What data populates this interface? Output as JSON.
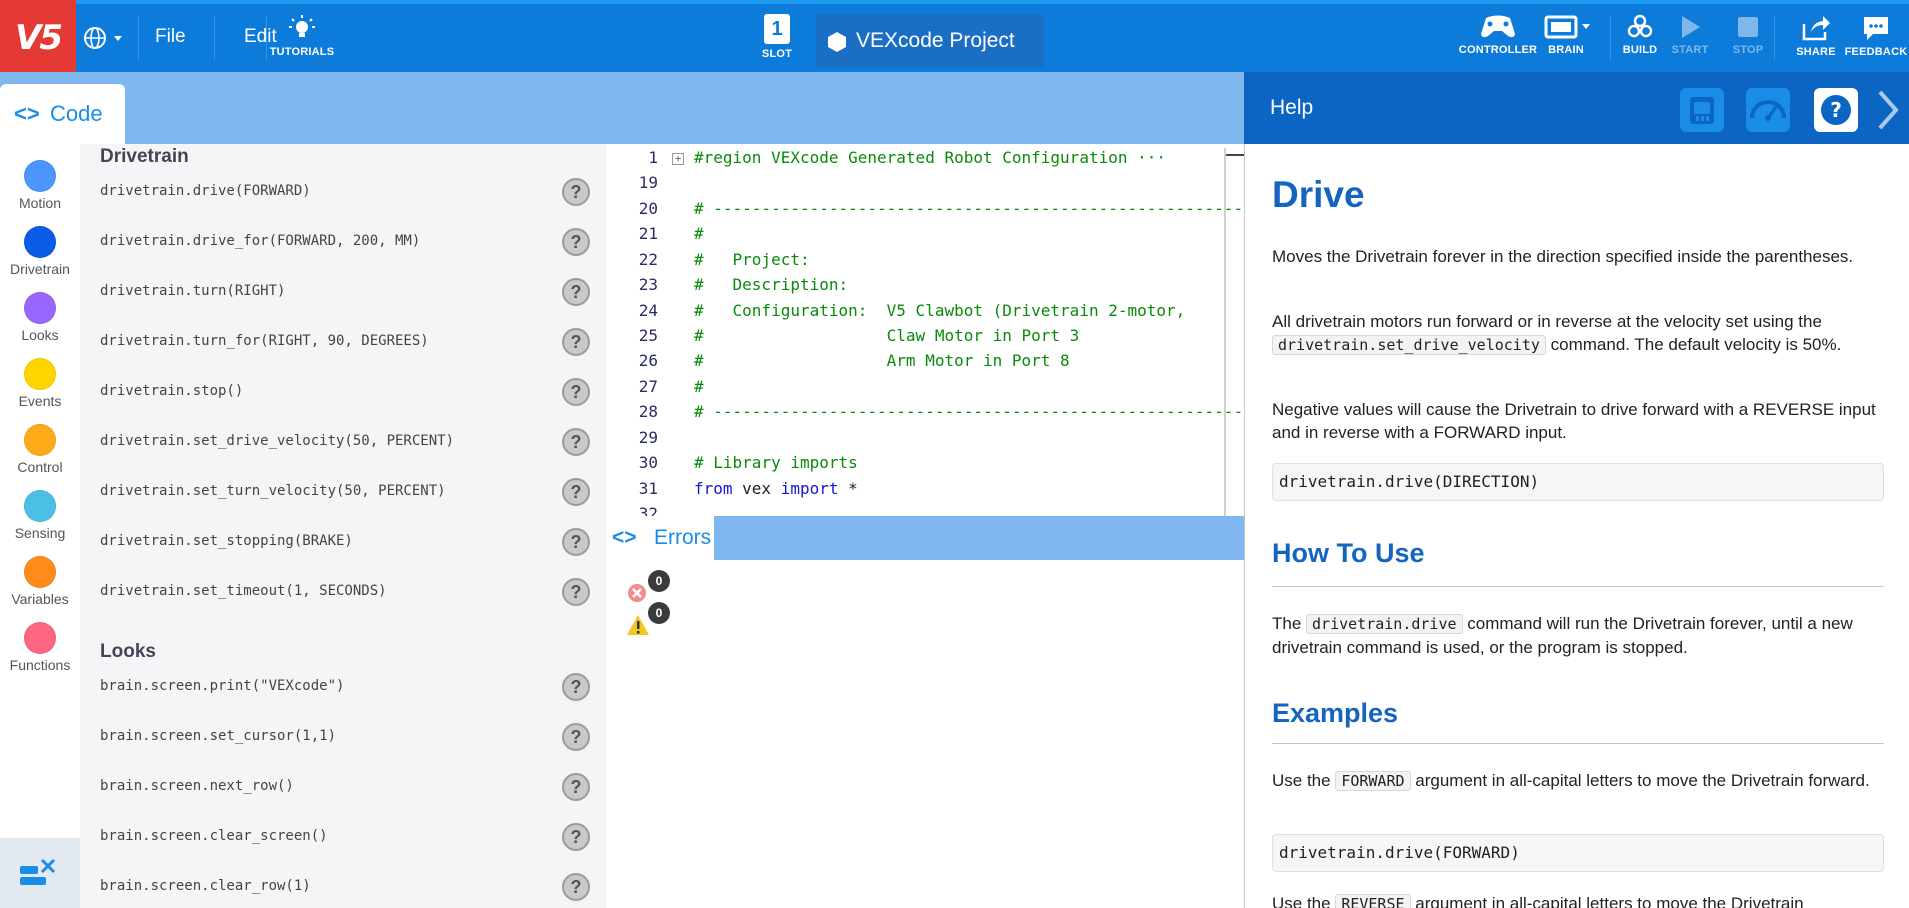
{
  "topbar": {
    "logo": "V5",
    "file": "File",
    "edit": "Edit",
    "tutorials": "TUTORIALS",
    "slot_number": "1",
    "slot": "SLOT",
    "project_name": "VEXcode Project",
    "controller": "CONTROLLER",
    "brain": "BRAIN",
    "build": "BUILD",
    "start": "START",
    "stop": "STOP",
    "share": "SHARE",
    "feedback": "FEEDBACK",
    "colors": {
      "bar": "#0c7bd9",
      "logo": "#e53935"
    }
  },
  "code_tab": {
    "label": "Code"
  },
  "categories": [
    {
      "label": "Motion",
      "color": "#4c97ff"
    },
    {
      "label": "Drivetrain",
      "color": "#0a5ce6"
    },
    {
      "label": "Looks",
      "color": "#9966ff"
    },
    {
      "label": "Events",
      "color": "#ffd500"
    },
    {
      "label": "Control",
      "color": "#ffab19"
    },
    {
      "label": "Sensing",
      "color": "#4cbfe6"
    },
    {
      "label": "Variables",
      "color": "#ff8c1a"
    },
    {
      "label": "Functions",
      "color": "#ff6680"
    }
  ],
  "palette": {
    "drivetrain_heading": "Drivetrain",
    "drivetrain": [
      "drivetrain.drive(FORWARD)",
      "drivetrain.drive_for(FORWARD, 200, MM)",
      "drivetrain.turn(RIGHT)",
      "drivetrain.turn_for(RIGHT, 90, DEGREES)",
      "drivetrain.stop()",
      "drivetrain.set_drive_velocity(50, PERCENT)",
      "drivetrain.set_turn_velocity(50, PERCENT)",
      "drivetrain.set_stopping(BRAKE)",
      "drivetrain.set_timeout(1, SECONDS)"
    ],
    "looks_heading": "Looks",
    "looks": [
      "brain.screen.print(\"VEXcode\")",
      "brain.screen.set_cursor(1,1)",
      "brain.screen.next_row()",
      "brain.screen.clear_screen()",
      "brain.screen.clear_row(1)"
    ],
    "help_mark": "?"
  },
  "editor": {
    "lines": [
      {
        "n": "1",
        "text": "#region VEXcode Generated Robot Configuration ···"
      },
      {
        "n": "19",
        "text": ""
      },
      {
        "n": "20",
        "text": "# ---------------------------------------------------------"
      },
      {
        "n": "21",
        "text": "#"
      },
      {
        "n": "22",
        "text": "#   Project:"
      },
      {
        "n": "23",
        "text": "#   Description:"
      },
      {
        "n": "24",
        "text": "#   Configuration:  V5 Clawbot (Drivetrain 2-motor,"
      },
      {
        "n": "25",
        "text": "#                   Claw Motor in Port 3"
      },
      {
        "n": "26",
        "text": "#                   Arm Motor in Port 8"
      },
      {
        "n": "27",
        "text": "#"
      },
      {
        "n": "28",
        "text": "# ---------------------------------------------------------"
      },
      {
        "n": "29",
        "text": ""
      },
      {
        "n": "30",
        "text": "# Library imports"
      },
      {
        "n": "32",
        "text": ""
      }
    ],
    "import_line": {
      "n": "31",
      "kw1": "from",
      "mid": " vex ",
      "kw2": "import",
      "rest": " *"
    },
    "fold_mark": "+"
  },
  "errors": {
    "tab_label": "Errors",
    "error_count": "0",
    "warning_count": "0"
  },
  "help": {
    "title": "Help",
    "heading": "Drive",
    "p1": "Moves the Drivetrain forever in the direction specified inside the parentheses.",
    "p2_a": "All drivetrain motors run forward or in reverse at the velocity set using the ",
    "p2_code": "drivetrain.set_drive_velocity",
    "p2_b": " command. The default velocity is 50%.",
    "p3": "Negative values will cause the Drivetrain to drive forward with a REVERSE input and in reverse with a FORWARD input.",
    "syntax": "drivetrain.drive(DIRECTION)",
    "how_heading": "How To Use",
    "p4_a": "The ",
    "p4_code": "drivetrain.drive",
    "p4_b": " command will run the Drivetrain forever, until a new drivetrain command is used, or the program is stopped.",
    "examples_heading": "Examples",
    "p5_a": "Use the ",
    "p5_code": "FORWARD",
    "p5_b": " argument in all-capital letters to move the Drivetrain forward.",
    "example1": "drivetrain.drive(FORWARD)",
    "p6_a": "Use the ",
    "p6_code": "REVERSE",
    "p6_b": " argument in all-capital letters to move the Drivetrain",
    "help_icon": "?"
  }
}
